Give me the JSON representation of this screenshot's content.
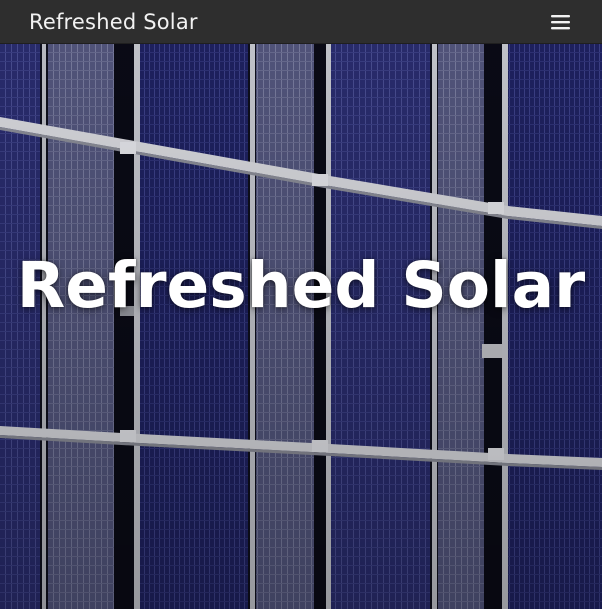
{
  "navbar": {
    "brand": "Refreshed Solar",
    "menu_icon": "hamburger-menu-icon"
  },
  "hero": {
    "title": "Refreshed Solar",
    "background": "solar-panels-photo"
  },
  "colors": {
    "navbar_bg": "#2e2e2e",
    "brand_text": "#f2f2f2",
    "panel_blue": "#272a6b",
    "frame_silver": "#d9dade",
    "gap_dark": "#0e0f1c"
  }
}
